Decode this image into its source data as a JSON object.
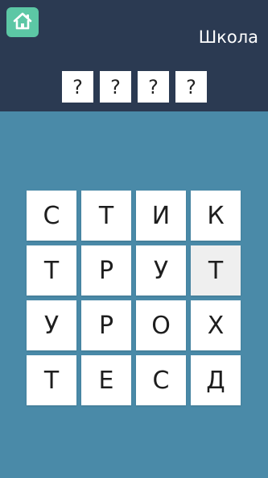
{
  "header": {
    "category": "Школа"
  },
  "answer": {
    "slots": [
      "?",
      "?",
      "?",
      "?"
    ]
  },
  "board": {
    "letters": [
      "С",
      "Т",
      "И",
      "К",
      "Т",
      "Р",
      "У",
      "Т",
      "У",
      "Р",
      "О",
      "Х",
      "Т",
      "Е",
      "С",
      "Д"
    ],
    "highlighted_index": 7
  },
  "colors": {
    "header_bg": "#2b3a52",
    "board_bg": "#4a8aa8",
    "home_button": "#5cc7a5",
    "tile": "#ffffff"
  }
}
